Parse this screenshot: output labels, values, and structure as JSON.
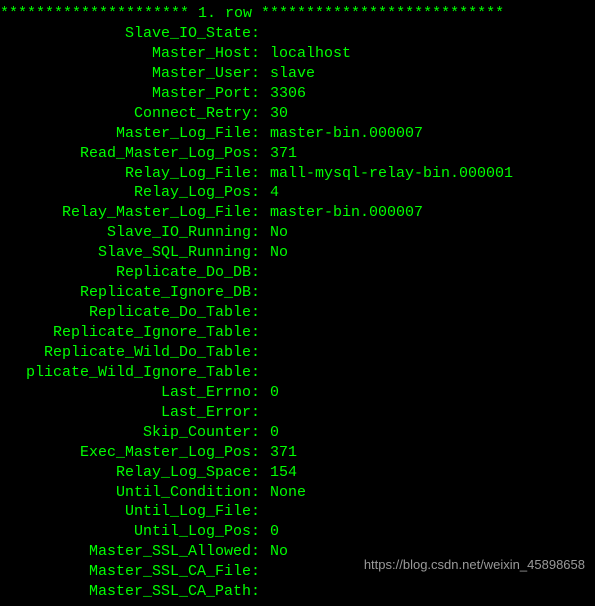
{
  "header": "********************* 1. row ***************************",
  "rows": [
    {
      "label": "Slave_IO_State:",
      "value": ""
    },
    {
      "label": "Master_Host:",
      "value": "localhost"
    },
    {
      "label": "Master_User:",
      "value": "slave"
    },
    {
      "label": "Master_Port:",
      "value": "3306"
    },
    {
      "label": "Connect_Retry:",
      "value": "30"
    },
    {
      "label": "Master_Log_File:",
      "value": "master-bin.000007"
    },
    {
      "label": "Read_Master_Log_Pos:",
      "value": "371"
    },
    {
      "label": "Relay_Log_File:",
      "value": "mall-mysql-relay-bin.000001"
    },
    {
      "label": "Relay_Log_Pos:",
      "value": "4"
    },
    {
      "label": "Relay_Master_Log_File:",
      "value": "master-bin.000007"
    },
    {
      "label": "Slave_IO_Running:",
      "value": "No"
    },
    {
      "label": "Slave_SQL_Running:",
      "value": "No"
    },
    {
      "label": "Replicate_Do_DB:",
      "value": ""
    },
    {
      "label": "Replicate_Ignore_DB:",
      "value": ""
    },
    {
      "label": "Replicate_Do_Table:",
      "value": ""
    },
    {
      "label": "Replicate_Ignore_Table:",
      "value": ""
    },
    {
      "label": "Replicate_Wild_Do_Table:",
      "value": ""
    },
    {
      "label": "plicate_Wild_Ignore_Table:",
      "value": ""
    },
    {
      "label": "Last_Errno:",
      "value": "0"
    },
    {
      "label": "Last_Error:",
      "value": ""
    },
    {
      "label": "Skip_Counter:",
      "value": "0"
    },
    {
      "label": "Exec_Master_Log_Pos:",
      "value": "371"
    },
    {
      "label": "Relay_Log_Space:",
      "value": "154"
    },
    {
      "label": "Until_Condition:",
      "value": "None"
    },
    {
      "label": "Until_Log_File:",
      "value": ""
    },
    {
      "label": "Until_Log_Pos:",
      "value": "0"
    },
    {
      "label": "Master_SSL_Allowed:",
      "value": "No"
    },
    {
      "label": "Master_SSL_CA_File:",
      "value": ""
    },
    {
      "label": "Master_SSL_CA_Path:",
      "value": ""
    }
  ],
  "watermark": "https://blog.csdn.net/weixin_45898658"
}
